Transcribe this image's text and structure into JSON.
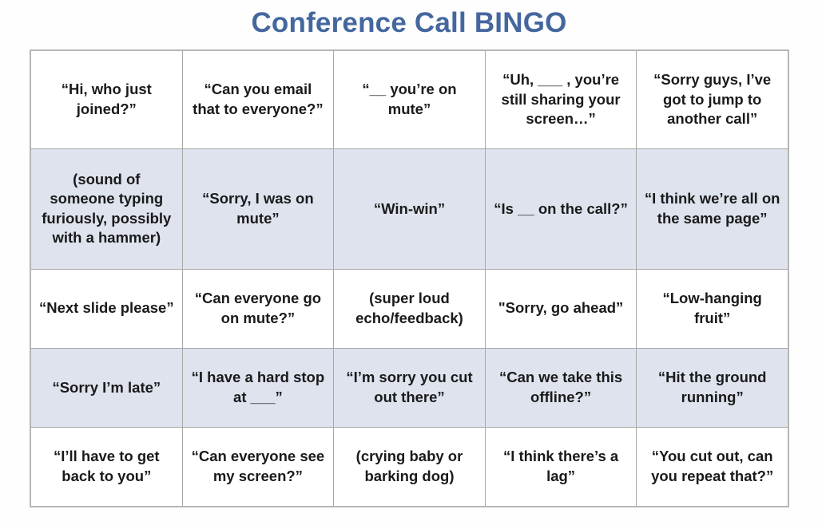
{
  "title": "Conference Call BINGO",
  "colors": {
    "title": "#44679e",
    "shaded_row_background": "#dee3ee",
    "cell_background": "#ffffff",
    "grid_border": "#a8a8a8",
    "outer_border": "#b6b6b6",
    "text": "#1a1a1a"
  },
  "grid": {
    "columns": 5,
    "rows": 5,
    "shaded_rows": [
      2,
      4
    ],
    "cells": [
      [
        "“Hi, who just joined?”",
        "“Can you email that to everyone?”",
        "“__ you’re on mute”",
        "“Uh, ___ , you’re still sharing your screen…”",
        "“Sorry guys, I’ve got to jump to another call”"
      ],
      [
        "(sound of someone typing furiously, possibly with a hammer)",
        "“Sorry, I was on mute”",
        "“Win-win”",
        "“Is __ on the call?”",
        "“I think we’re all on the same page”"
      ],
      [
        "“Next slide please”",
        "“Can everyone go on mute?”",
        "(super loud echo/feedback)",
        "\"Sorry, go ahead”",
        "“Low-hanging fruit”"
      ],
      [
        "“Sorry I’m late”",
        "“I have a hard stop at ___”",
        "“I’m sorry you cut out there”",
        "“Can we take this offline?”",
        "“Hit the ground running”"
      ],
      [
        "“I’ll have to get back to you”",
        "“Can everyone see my screen?”",
        "(crying baby or barking dog)",
        "“I think there’s a lag”",
        "“You cut out, can you repeat that?”"
      ]
    ]
  }
}
